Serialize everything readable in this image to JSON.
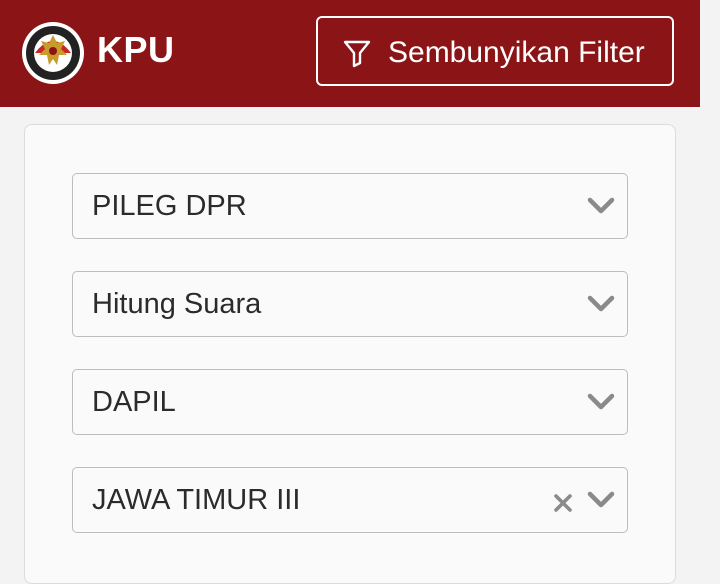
{
  "header": {
    "brand": "KPU",
    "filter_button_label": "Sembunyikan Filter",
    "background_color": "#8b1516"
  },
  "filters": [
    {
      "value": "PILEG DPR",
      "clearable": false
    },
    {
      "value": "Hitung Suara",
      "clearable": false
    },
    {
      "value": "DAPIL",
      "clearable": false
    },
    {
      "value": "JAWA TIMUR III",
      "clearable": true
    }
  ],
  "icons": {
    "logo": "kpu-garuda-logo-icon",
    "filter": "filter-funnel-icon",
    "chevron": "chevron-down-icon",
    "clear": "close-x-icon"
  }
}
